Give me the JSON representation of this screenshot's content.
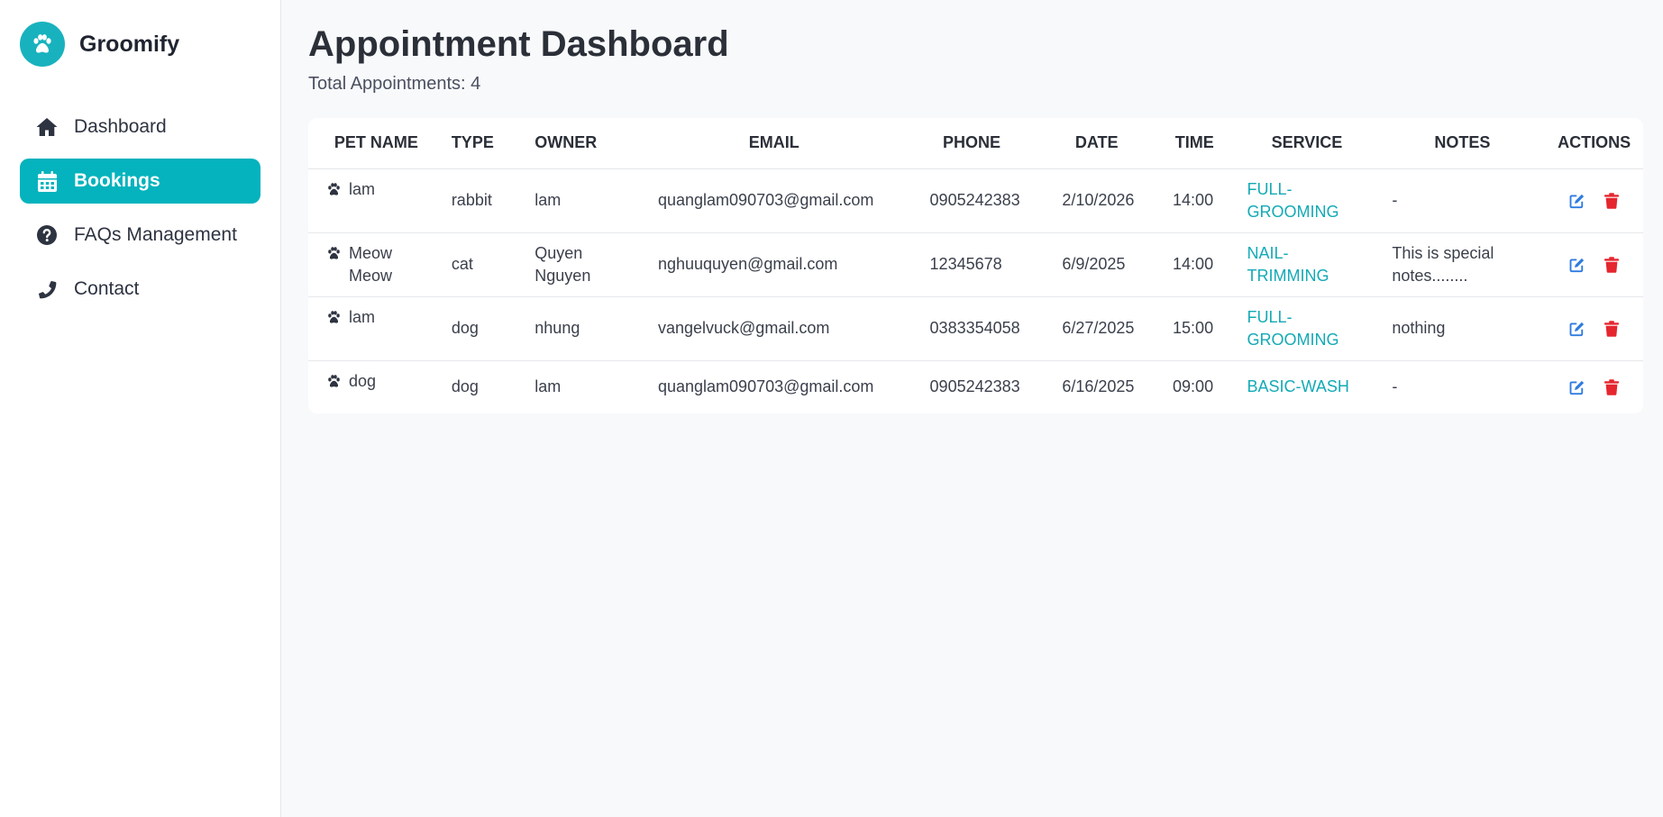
{
  "brand": {
    "name": "Groomify",
    "icon": "paw-icon"
  },
  "sidebar": {
    "items": [
      {
        "label": "Dashboard",
        "icon": "home-icon",
        "active": false
      },
      {
        "label": "Bookings",
        "icon": "calendar-icon",
        "active": true
      },
      {
        "label": "FAQs Management",
        "icon": "question-circle-icon",
        "active": false
      },
      {
        "label": "Contact",
        "icon": "phone-icon",
        "active": false
      }
    ]
  },
  "main": {
    "title": "Appointment Dashboard",
    "subtitle": "Total Appointments: 4"
  },
  "table": {
    "columns": [
      "PET NAME",
      "TYPE",
      "OWNER",
      "EMAIL",
      "PHONE",
      "DATE",
      "TIME",
      "SERVICE",
      "NOTES",
      "ACTIONS"
    ],
    "rows": [
      {
        "pet": "lam",
        "type": "rabbit",
        "owner": "lam",
        "email": "quanglam090703@gmail.com",
        "phone": "0905242383",
        "date": "2/10/2026",
        "time": "14:00",
        "service": "FULL-\nGROOMING",
        "notes": "-"
      },
      {
        "pet": "Meow Meow",
        "type": "cat",
        "owner": "Quyen Nguyen",
        "email": "nghuuquyen@gmail.com",
        "phone": "12345678",
        "date": "6/9/2025",
        "time": "14:00",
        "service": "NAIL-\nTRIMMING",
        "notes": "This is special notes........"
      },
      {
        "pet": "lam",
        "type": "dog",
        "owner": "nhung",
        "email": "vangelvuck@gmail.com",
        "phone": "0383354058",
        "date": "6/27/2025",
        "time": "15:00",
        "service": "FULL-\nGROOMING",
        "notes": "nothing"
      },
      {
        "pet": "dog",
        "type": "dog",
        "owner": "lam",
        "email": "quanglam090703@gmail.com",
        "phone": "0905242383",
        "date": "6/16/2025",
        "time": "09:00",
        "service": "BASIC-WASH",
        "notes": "-"
      }
    ]
  },
  "colors": {
    "accent": "#04b3bd",
    "service_text": "#13aab6",
    "edit_icon": "#2f7be0",
    "delete_icon": "#e5262e"
  }
}
